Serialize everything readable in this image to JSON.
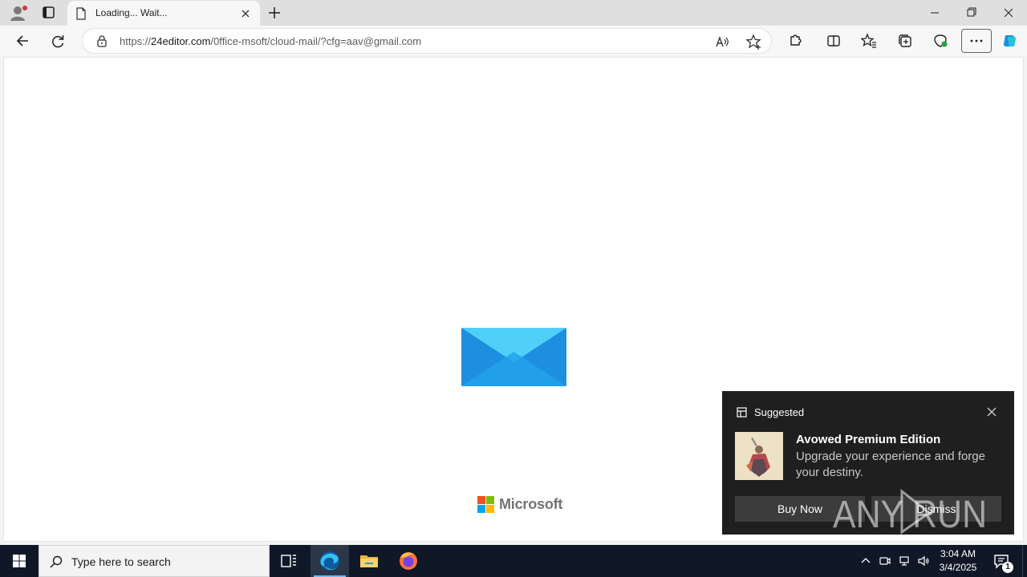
{
  "browser": {
    "tab": {
      "title": "Loading... Wait..."
    },
    "address_bar": {
      "url_prefix": "https://",
      "url_host": "24editor.com",
      "url_path": "/0ffice-msoft/cloud-mail/?cfg=aav@gmail.com"
    }
  },
  "page": {
    "logo_text": "Microsoft",
    "logo_colors": [
      "#f25022",
      "#7fba00",
      "#00a4ef",
      "#ffb900"
    ],
    "envelope_colors": [
      "#1e8fe0",
      "#50d0f8",
      "#23a2ea"
    ]
  },
  "toast": {
    "header": "Suggested",
    "title": "Avowed Premium Edition",
    "body": "Upgrade your experience and forge your destiny.",
    "buttons": {
      "primary": "Buy Now",
      "secondary": "Dismiss"
    }
  },
  "watermark": {
    "text": "ANY RUN"
  },
  "taskbar": {
    "search_placeholder": "Type here to search",
    "clock": {
      "time": "3:04 AM",
      "date": "3/4/2025"
    },
    "notification_count": "1",
    "accent_color": "#76b9ed"
  }
}
